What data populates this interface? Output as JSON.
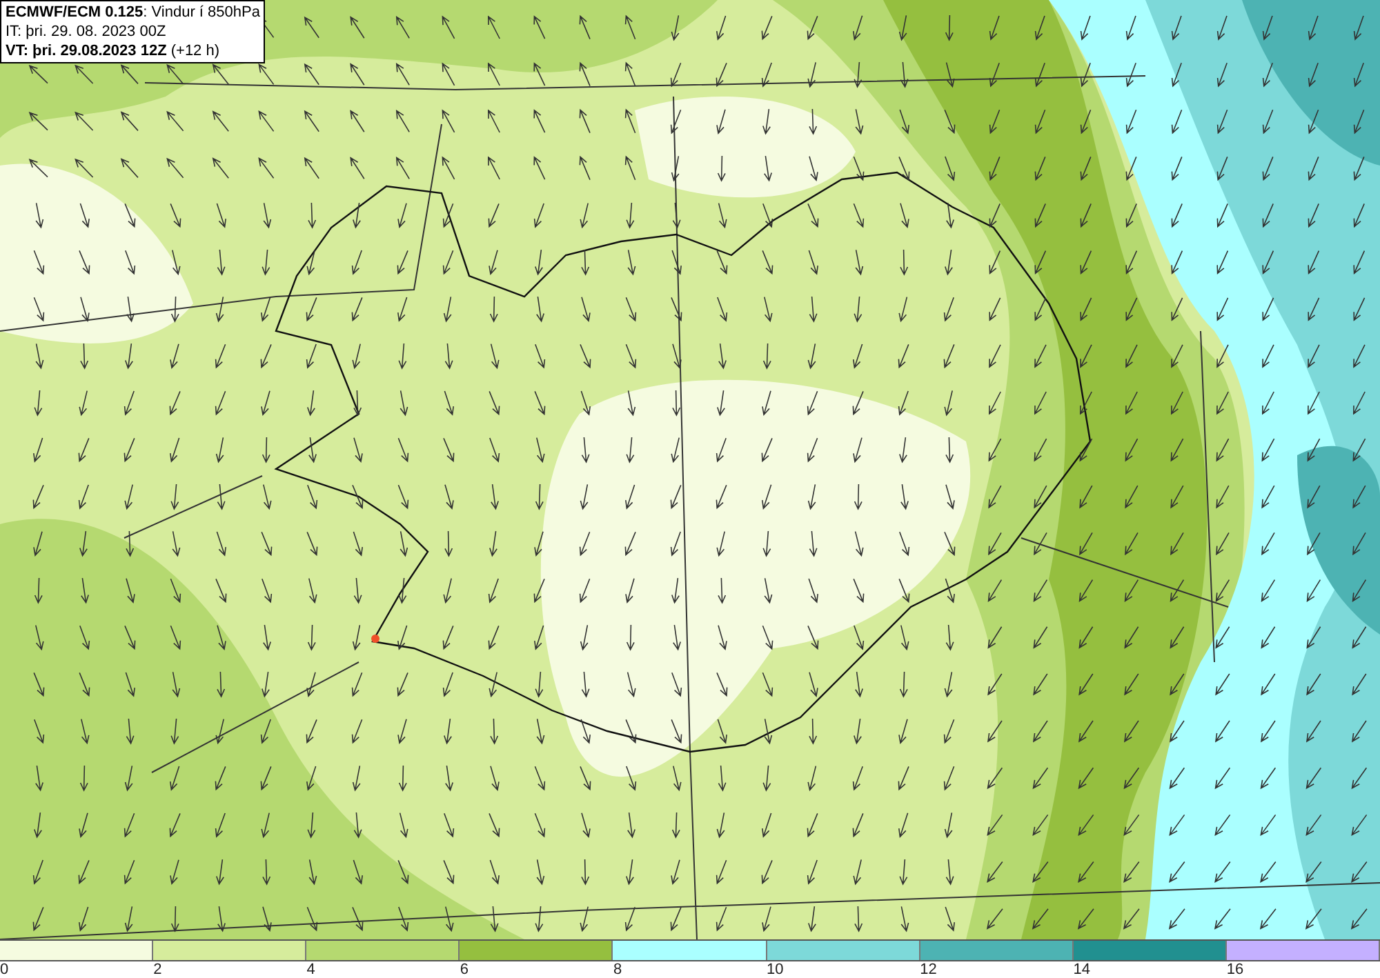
{
  "header": {
    "lines": [
      "**ECMWF/ECM 0.125**: Vindur í 850hPa",
      "IT: þri. 29. 08. 2023 00Z",
      "**VT: þri. 29.08.2023 12Z** (+12 h)"
    ]
  },
  "legend": [
    {
      "label": "0",
      "color": "#f5fbe0"
    },
    {
      "label": "2",
      "color": "#d6ec9c"
    },
    {
      "label": "4",
      "color": "#b5d970"
    },
    {
      "label": "6",
      "color": "#95bf3f"
    },
    {
      "label": "8",
      "color": "#aaffff"
    },
    {
      "label": "10",
      "color": "#7dd9d9"
    },
    {
      "label": "12",
      "color": "#4db3b3"
    },
    {
      "label": "14",
      "color": "#219090"
    },
    {
      "label": "16",
      "color": "#c4b0ff"
    }
  ]
}
